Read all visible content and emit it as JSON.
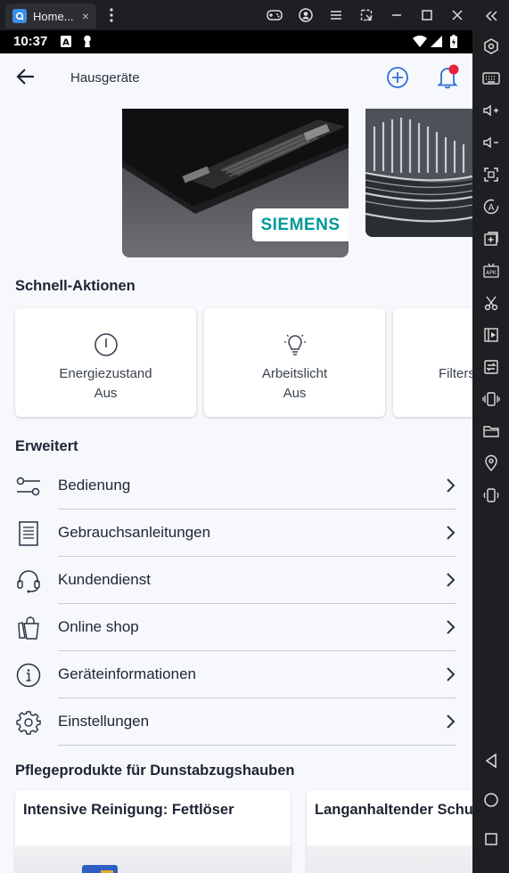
{
  "window": {
    "tab_title": "Home...",
    "tab_close": "×"
  },
  "statusbar": {
    "time": "10:37"
  },
  "appbar": {
    "title": "Hausgeräte"
  },
  "hero": {
    "brand": "SIEMENS"
  },
  "quick_actions": {
    "title": "Schnell-Aktionen",
    "items": [
      {
        "label": "Energiezustand",
        "value": "Aus",
        "icon": "power-icon"
      },
      {
        "label": "Arbeitslicht",
        "value": "Aus",
        "icon": "lightbulb-icon"
      },
      {
        "label": "Filters",
        "value": "(",
        "icon": "filter-icon"
      }
    ]
  },
  "advanced": {
    "title": "Erweitert",
    "items": [
      {
        "label": "Bedienung",
        "icon": "sliders-icon"
      },
      {
        "label": "Gebrauchsanleitungen",
        "icon": "document-icon"
      },
      {
        "label": "Kundendienst",
        "icon": "headset-icon"
      },
      {
        "label": "Online shop",
        "icon": "shopping-bag-icon"
      },
      {
        "label": "Geräteinformationen",
        "icon": "info-icon"
      },
      {
        "label": "Einstellungen",
        "icon": "gear-icon"
      }
    ]
  },
  "care_products": {
    "title": "Pflegeprodukte für Dunstabzugshauben",
    "items": [
      {
        "title": "Intensive Reinigung: Fettlöser"
      },
      {
        "title": "Langanhaltender Schu"
      }
    ]
  },
  "colors": {
    "accent": "#2f6fd6",
    "notification": "#e8203a",
    "siemens_teal": "#009999"
  }
}
